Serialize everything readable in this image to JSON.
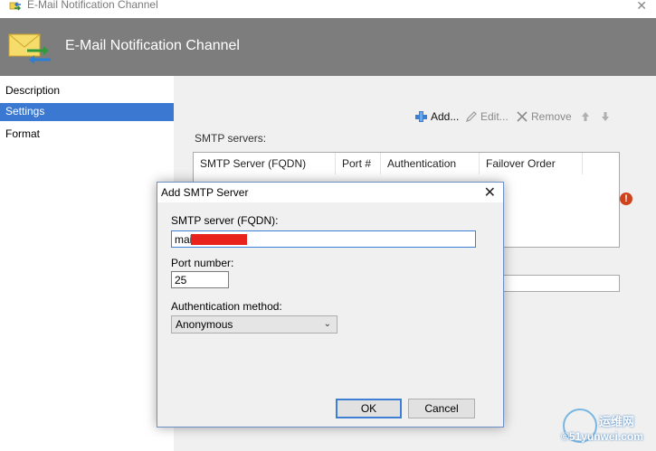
{
  "window": {
    "title": "E-Mail Notification Channel",
    "close_glyph": "✕"
  },
  "banner": {
    "heading": "E-Mail Notification Channel",
    "icon": "envelope-arrows-icon"
  },
  "nav": {
    "items": [
      {
        "label": "Description",
        "active": false
      },
      {
        "label": "Settings",
        "active": true
      },
      {
        "label": "Format",
        "active": false
      }
    ],
    "active_color": "#3a78d1"
  },
  "toolbar": {
    "add_label": "Add...",
    "edit_label": "Edit...",
    "remove_label": "Remove"
  },
  "smtp": {
    "label": "SMTP servers:",
    "columns": [
      "SMTP Server (FQDN)",
      "Port #",
      "Authentication",
      "Failover Order"
    ]
  },
  "dialog": {
    "title": "Add SMTP Server",
    "fqdn_label": "SMTP server (FQDN):",
    "fqdn_value": "mail",
    "port_label": "Port number:",
    "port_value": "25",
    "auth_label": "Authentication method:",
    "auth_selected": "Anonymous",
    "ok_label": "OK",
    "cancel_label": "Cancel",
    "focus_color": "#3c7fd5",
    "redaction_color": "#e8231c"
  },
  "watermark": {
    "line1": "运维网",
    "line2": "©51yunwei.com"
  }
}
